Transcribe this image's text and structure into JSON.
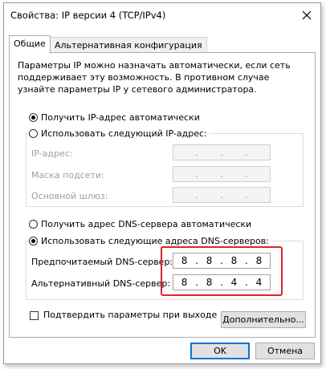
{
  "window": {
    "title": "Свойства: IP версии 4 (TCP/IPv4)"
  },
  "tabs": [
    {
      "label": "Общие",
      "active": true
    },
    {
      "label": "Альтернативная конфигурация",
      "active": false
    }
  ],
  "description": "Параметры IP можно назначать автоматически, если сеть поддерживает эту возможность. В противном случае узнайте параметры IP у сетевого администратора.",
  "ip_settings": {
    "auto_label": "Получить IP-адрес автоматически",
    "auto_selected": true,
    "manual_label": "Использовать следующий IP-адрес:",
    "manual_selected": false,
    "fields": [
      {
        "label": "IP-адрес:",
        "value": [
          "",
          "",
          "",
          ""
        ]
      },
      {
        "label": "Маска подсети:",
        "value": [
          "",
          "",
          "",
          ""
        ]
      },
      {
        "label": "Основной шлюз:",
        "value": [
          "",
          "",
          "",
          ""
        ]
      }
    ]
  },
  "dns_settings": {
    "auto_label": "Получить адрес DNS-сервера автоматически",
    "auto_selected": false,
    "manual_label": "Использовать следующие адреса DNS-серверов:",
    "manual_selected": true,
    "preferred_label": "Предпочитаемый DNS-сервер:",
    "preferred_value": [
      "8",
      "8",
      "8",
      "8"
    ],
    "alternate_label": "Альтернативный DNS-сервер:",
    "alternate_value": [
      "8",
      "8",
      "4",
      "4"
    ]
  },
  "validate_label": "Подтвердить параметры при выходе",
  "validate_checked": false,
  "buttons": {
    "advanced": "Дополнительно...",
    "ok": "OK",
    "cancel": "Отмена"
  },
  "colors": {
    "highlight": "#d9262c",
    "accent": "#0078d7"
  }
}
